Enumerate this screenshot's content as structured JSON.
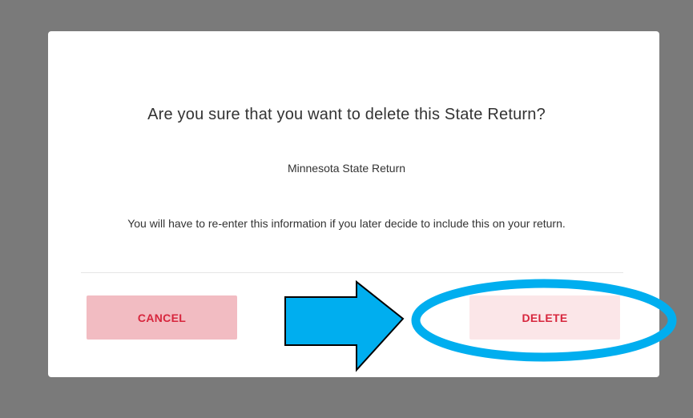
{
  "dialog": {
    "title": "Are you sure that you want to delete this State Return?",
    "state_name": "Minnesota State Return",
    "message": "You will have to re-enter this information if you later decide to include this on your return.",
    "cancel_label": "CANCEL",
    "delete_label": "DELETE"
  },
  "colors": {
    "overlay": "#7a7a7a",
    "button_text": "#d7263d",
    "cancel_bg": "#f2bcc2",
    "delete_bg": "#fbe6e8",
    "annotation_blue": "#00aeef"
  },
  "annotation": {
    "arrow_icon": "right-arrow-icon",
    "highlight_icon": "highlight-ellipse-icon"
  }
}
